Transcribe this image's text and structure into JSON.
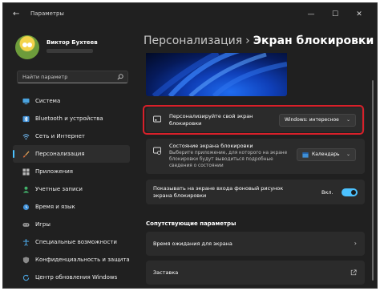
{
  "window": {
    "title": "Параметры",
    "back_glyph": "←",
    "minimize_glyph": "—",
    "maximize_glyph": "☐",
    "close_glyph": "✕"
  },
  "profile": {
    "name": "Виктор Бухтеев"
  },
  "search": {
    "placeholder": "Найти параметр"
  },
  "sidebar": {
    "items": [
      {
        "label": "Система",
        "icon": "monitor-icon",
        "active": false
      },
      {
        "label": "Bluetooth и устройства",
        "icon": "bluetooth-icon",
        "active": false
      },
      {
        "label": "Сеть и Интернет",
        "icon": "network-icon",
        "active": false
      },
      {
        "label": "Персонализация",
        "icon": "brush-icon",
        "active": true
      },
      {
        "label": "Приложения",
        "icon": "apps-icon",
        "active": false
      },
      {
        "label": "Учетные записи",
        "icon": "person-icon",
        "active": false
      },
      {
        "label": "Время и язык",
        "icon": "globe-clock-icon",
        "active": false
      },
      {
        "label": "Игры",
        "icon": "gamepad-icon",
        "active": false
      },
      {
        "label": "Специальные возможности",
        "icon": "accessibility-icon",
        "active": false
      },
      {
        "label": "Конфиденциальность и защита",
        "icon": "shield-icon",
        "active": false
      },
      {
        "label": "Центр обновления Windows",
        "icon": "update-icon",
        "active": false
      }
    ]
  },
  "breadcrumb": {
    "parent": "Персонализация",
    "separator": "›",
    "current": "Экран блокировки"
  },
  "settings": {
    "personalize": {
      "title_line1": "Персонализируйте свой экран",
      "title_line2": "блокировки",
      "value": "Windows: интересное"
    },
    "status": {
      "title": "Состояние экрана блокировки",
      "desc_line1": "Выберите приложение, для которого на экране",
      "desc_line2": "блокировки будут выводиться подробные",
      "desc_line3": "сведения о состоянии",
      "value": "Календарь"
    },
    "signin_background": {
      "title_line1": "Показывать на экране входа фоновый рисунок",
      "title_line2": "экрана блокировки",
      "toggle_label": "Вкл.",
      "toggle_on": true
    }
  },
  "related": {
    "title": "Сопутствующие параметры",
    "items": [
      {
        "label": "Время ожидания для экрана"
      },
      {
        "label": "Заставка"
      }
    ]
  },
  "colors": {
    "accent": "#4cc2ff",
    "highlight": "#d8202a",
    "background": "#202020",
    "card": "#2b2b2b"
  }
}
